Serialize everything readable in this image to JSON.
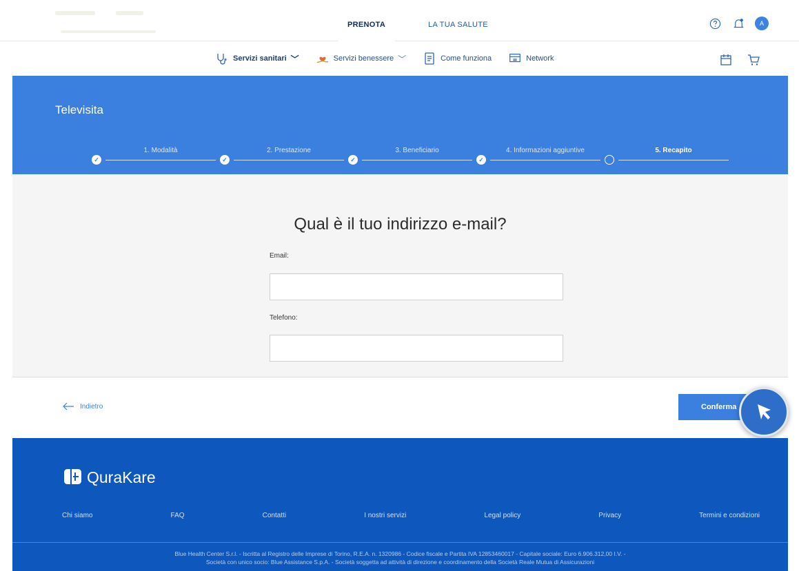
{
  "header": {
    "tabs": [
      {
        "label": "PRENOTA",
        "active": true
      },
      {
        "label": "LA TUA SALUTE",
        "active": false
      }
    ],
    "icons": [
      "help-icon",
      "bell-icon",
      "avatar"
    ],
    "avatar_initial": "A"
  },
  "subnav": {
    "items": [
      {
        "label": "Servizi sanitari",
        "icon": "stethoscope-icon",
        "has_dropdown": true
      },
      {
        "label": "Servizi benessere",
        "icon": "wellness-icon",
        "has_dropdown": true
      },
      {
        "label": "Come funziona",
        "icon": "document-icon",
        "has_dropdown": false
      },
      {
        "label": "Network",
        "icon": "network-icon",
        "has_dropdown": false
      }
    ],
    "right_icons": [
      "calendar-icon",
      "cart-icon"
    ]
  },
  "band": {
    "title": "Televisita",
    "steps": [
      {
        "label": "1. Modalità",
        "done": true
      },
      {
        "label": "2. Prestazione",
        "done": true
      },
      {
        "label": "3. Beneficiario",
        "done": true
      },
      {
        "label": "4. Informazioni aggiuntive",
        "done": true
      },
      {
        "label": "5. Recapito",
        "done": false,
        "active": true
      }
    ]
  },
  "form": {
    "question": "Qual è il tuo indirizzo e-mail?",
    "email_label": "Email:",
    "email_value": "",
    "phone_label": "Telefono:",
    "phone_value": ""
  },
  "actions": {
    "back_label": "Indietro",
    "confirm_label": "Conferma"
  },
  "footer": {
    "brand": "QuraKare",
    "links": [
      "Chi siamo",
      "FAQ",
      "Contatti",
      "I nostri servizi",
      "Legal policy",
      "Privacy",
      "Termini e condizioni"
    ],
    "legal_line1": "Blue Health Center S.r.l. - Iscritta al Registro delle Imprese di Torino, R.E.A. n. 1320986 - Codice fiscale e Partita IVA 12853460017 - Capitale sociale: Euro 6.906.312,00 I.V. -",
    "legal_line2": "Società con unico socio: Blue Assistance S.p.A. - Società soggetta ad attività di direzione e coordinamento della Società Reale Mutua di Assicurazioni"
  },
  "colors": {
    "primary": "#3c80df",
    "footer": "#0d57bd",
    "text_dark": "#2b2b2b"
  }
}
